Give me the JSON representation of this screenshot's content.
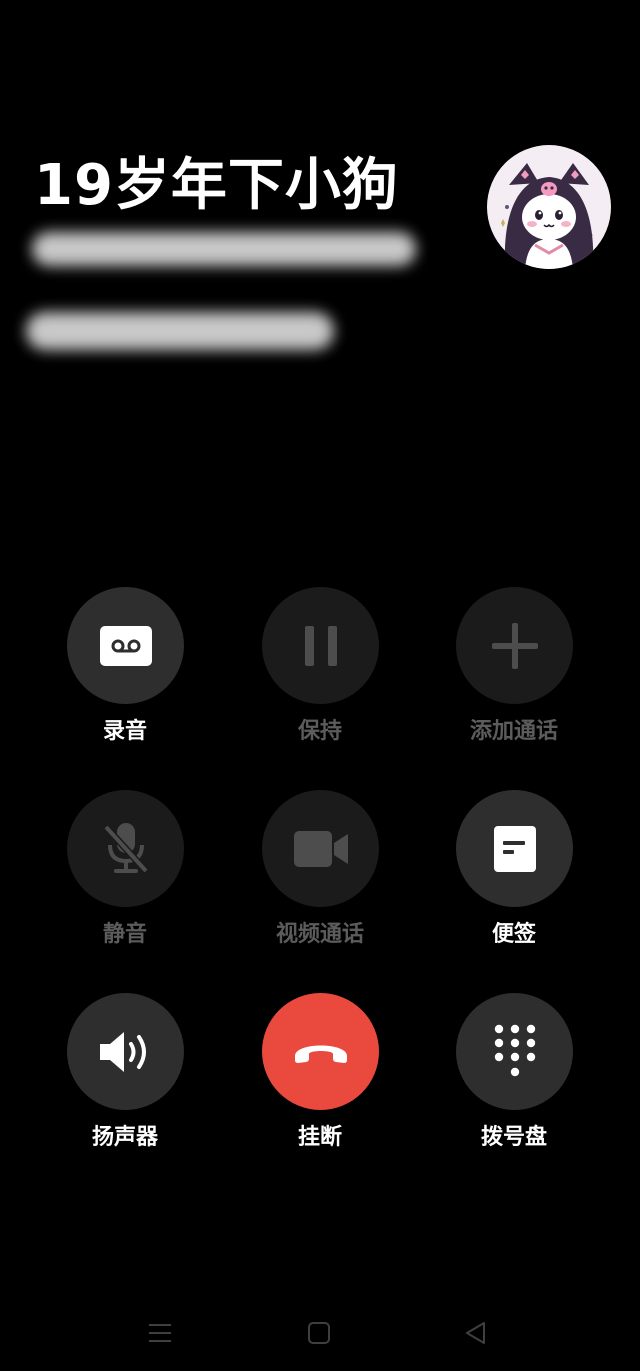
{
  "caller": {
    "name": "19岁年下小狗"
  },
  "controls": [
    {
      "id": "record",
      "label": "录音",
      "icon": "recorder-icon",
      "enabled": true
    },
    {
      "id": "hold",
      "label": "保持",
      "icon": "pause-icon",
      "enabled": false
    },
    {
      "id": "add-call",
      "label": "添加通话",
      "icon": "plus-icon",
      "enabled": false
    },
    {
      "id": "mute",
      "label": "静音",
      "icon": "mic-off-icon",
      "enabled": false
    },
    {
      "id": "video-call",
      "label": "视频通话",
      "icon": "video-camera-icon",
      "enabled": false
    },
    {
      "id": "notes",
      "label": "便签",
      "icon": "note-icon",
      "enabled": true
    },
    {
      "id": "speaker",
      "label": "扬声器",
      "icon": "speaker-icon",
      "enabled": true
    },
    {
      "id": "hangup",
      "label": "挂断",
      "icon": "phone-hangup-icon",
      "enabled": true
    },
    {
      "id": "dialpad",
      "label": "拨号盘",
      "icon": "dialpad-icon",
      "enabled": true
    }
  ],
  "navbar": {
    "items": [
      "menu-icon",
      "home-square-icon",
      "back-triangle-icon"
    ]
  },
  "colors": {
    "background": "#000000",
    "button": "#2e2e2e",
    "button_disabled": "#1b1b1b",
    "hangup": "#ea4a3e",
    "label_disabled": "#5c5c5c"
  }
}
